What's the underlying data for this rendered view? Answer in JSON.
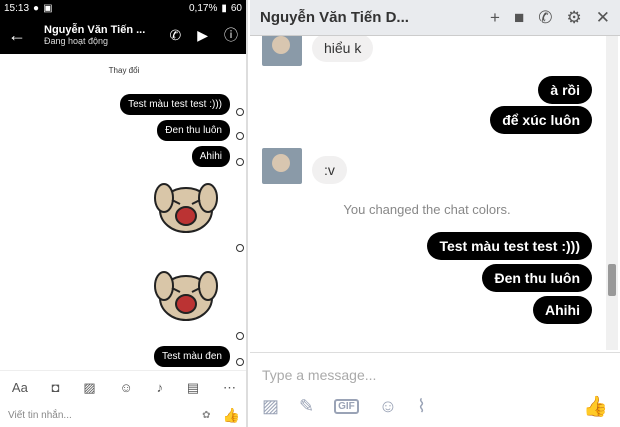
{
  "mobile": {
    "status": {
      "time": "15:13",
      "battery_pct": "0,17",
      "battery_suffix": "%",
      "level": "60"
    },
    "header": {
      "name": "Nguyễn Văn Tiến ...",
      "status": "Đang hoạt động"
    },
    "system_note": "Thay đổi",
    "messages": [
      "Test màu test test :)))",
      "Đen thu luôn",
      "Ahihi",
      "Test màu đen"
    ],
    "input_placeholder": "Viết tin nhắn..."
  },
  "desktop": {
    "header": {
      "name": "Nguyễn Văn Tiến D..."
    },
    "incoming": [
      "hiểu k",
      ":v"
    ],
    "outgoing_top": [
      "à rồi",
      "để xúc luôn"
    ],
    "system_note": "You changed the chat colors.",
    "outgoing": [
      "Test màu test test :)))",
      "Đen thu luôn",
      "Ahihi"
    ],
    "input_placeholder": "Type a message...",
    "gif_label": "GIF"
  },
  "colors": {
    "bubble": "#000000",
    "bubble_text": "#ffffff",
    "header_bg": "#e9ebee"
  }
}
